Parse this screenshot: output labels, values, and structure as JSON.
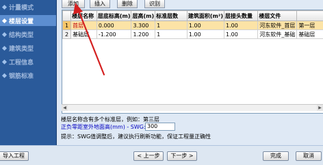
{
  "sidebar": {
    "items": [
      {
        "label": "计量模式"
      },
      {
        "label": "楼层设置"
      },
      {
        "label": "结构类型"
      },
      {
        "label": "建筑类型"
      },
      {
        "label": "工程信息"
      },
      {
        "label": "钢筋标准"
      }
    ]
  },
  "toolbar": {
    "add_label": "添加",
    "insert_label": "插入",
    "delete_label": "删除",
    "recognize_label": "识别"
  },
  "table": {
    "columns": [
      "楼层名称",
      "层底标高(m)",
      "层高(m)",
      "标准层数",
      "建筑面积(m²)",
      "层接头数量",
      "楼层文件",
      ""
    ],
    "rows": [
      {
        "num": "1",
        "cells": [
          "首层",
          "0.000",
          "3.300",
          "1",
          "1.00",
          "1.00",
          "河东软件_首层",
          "第一层"
        ]
      },
      {
        "num": "2",
        "cells": [
          "基础层",
          "-1.200",
          "1.200",
          "1",
          "1.00",
          "1.00",
          "河东软件_基础",
          "基础层"
        ]
      }
    ]
  },
  "info": {
    "standard_floor_note": "楼层名称含有多个标准层，例如：第三层",
    "outdoor_label": "正负零距室外地面高(mm) - SWG:",
    "outdoor_value": "300",
    "tip": "提示：SWG值调整后，建议执行刷新功能，保证工程量正确性"
  },
  "bottom": {
    "import_label": "导入工程",
    "prev_label": "< 上一步",
    "next_label": "下一步 >",
    "finish_label": "完成",
    "cancel_label": "取消"
  },
  "colors": {
    "sidebar": "#2a5a9a",
    "sidebar_active": "#5c8ed0",
    "selected_row": "#fce3a6",
    "arrow": "#d42020"
  }
}
